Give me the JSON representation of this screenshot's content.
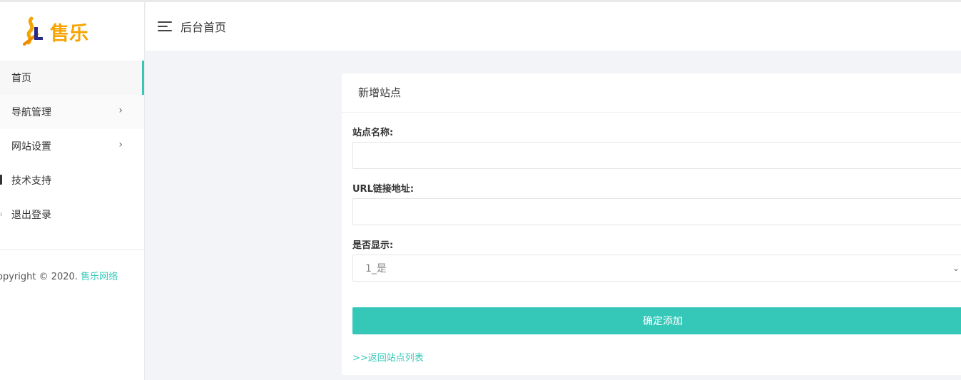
{
  "brand": {
    "logo_text": "售乐",
    "logo_icon": "sl-logo-icon",
    "accent_color": "#35c8b8",
    "logo_color": "#f5a400"
  },
  "sidebar": {
    "items": [
      {
        "label": "首页",
        "active": true
      },
      {
        "label": "导航管理",
        "has_submenu": true
      },
      {
        "label": "网站设置",
        "has_submenu": true
      },
      {
        "label": "技术支持"
      },
      {
        "label": "退出登录"
      }
    ],
    "copyright_prefix": "opyright © 2020.",
    "copyright_link": "售乐网络"
  },
  "header": {
    "menu_icon": "hamburger-icon",
    "title": "后台首页"
  },
  "card": {
    "title": "新增站点",
    "fields": {
      "site_name_label": "站点名称:",
      "site_name_value": "",
      "url_label": "URL链接地址:",
      "url_value": "",
      "display_label": "是否显示:",
      "display_selected": "1_是"
    },
    "submit_label": "确定添加",
    "back_link": ">>返回站点列表"
  }
}
